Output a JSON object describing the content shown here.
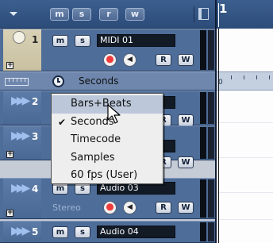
{
  "toolbar": {
    "buttons": [
      {
        "label": "m",
        "name": "global-mute-button"
      },
      {
        "label": "s",
        "name": "global-solo-button"
      },
      {
        "label": "r",
        "name": "global-read-button"
      },
      {
        "label": "w",
        "name": "global-write-button"
      }
    ]
  },
  "ruler": {
    "bar_number": "1"
  },
  "tracks": [
    {
      "number": "1",
      "name": "MIDI 01",
      "type": "midi"
    },
    {
      "number": "2",
      "name": "",
      "type": "audio"
    },
    {
      "number": "3",
      "name": "",
      "type": "audio"
    },
    {
      "number": "4",
      "name": "Audio 03",
      "type": "audio",
      "channel": "Stereo"
    },
    {
      "number": "5",
      "name": "Audio 04",
      "type": "audio"
    }
  ],
  "track_buttons": {
    "mute": "m",
    "solo": "s",
    "read": "R",
    "write": "W"
  },
  "ruler_track": {
    "format_label": "Seconds"
  },
  "time_format_menu": {
    "selected": "Seconds",
    "hovered": "Bars+Beats",
    "items": [
      "Bars+Beats",
      "Seconds",
      "Timecode",
      "Samples",
      "60 fps (User)"
    ]
  },
  "arrange_ruler_label": "0"
}
